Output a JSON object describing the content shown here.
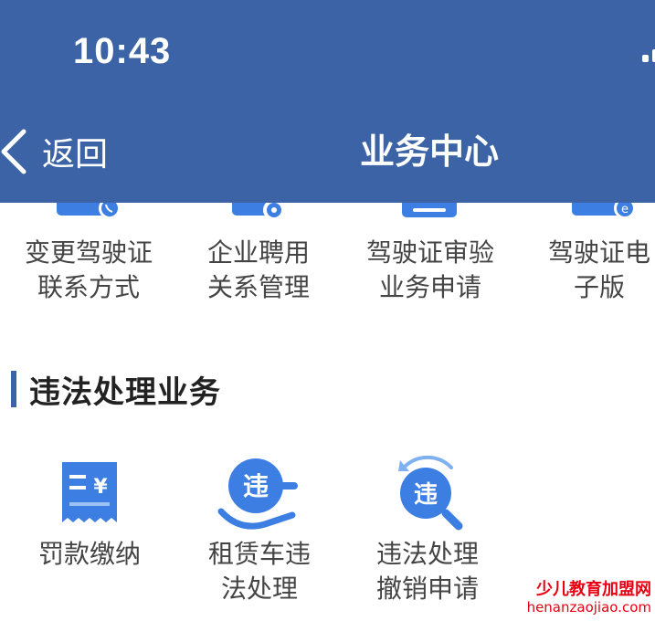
{
  "status_bar": {
    "time": "10:43"
  },
  "nav": {
    "back_label": "返回",
    "title": "业务中心"
  },
  "top_items": [
    {
      "label": "变更驾驶证\n联系方式",
      "icon": "phone-card-icon"
    },
    {
      "label": "企业聘用\n关系管理",
      "icon": "gear-card-icon"
    },
    {
      "label": "驾驶证审验\n业务申请",
      "icon": "card-icon"
    },
    {
      "label": "驾驶证电\n子版",
      "icon": "e-card-icon"
    }
  ],
  "section": {
    "title": "违法处理业务"
  },
  "violation_items": [
    {
      "label": "罚款缴纳",
      "icon": "receipt-yuan-icon"
    },
    {
      "label": "租赁车违\n法处理",
      "icon": "hand-violation-icon"
    },
    {
      "label": "违法处理\n撤销申请",
      "icon": "search-violation-icon"
    }
  ],
  "icon_badge_text": "违",
  "watermark": {
    "line1": "少儿教育加盟网",
    "line2": "henanzaojiao.com"
  },
  "colors": {
    "header": "#3b63a6",
    "icon_blue": "#2f7fe0",
    "watermark": "#e60012"
  }
}
